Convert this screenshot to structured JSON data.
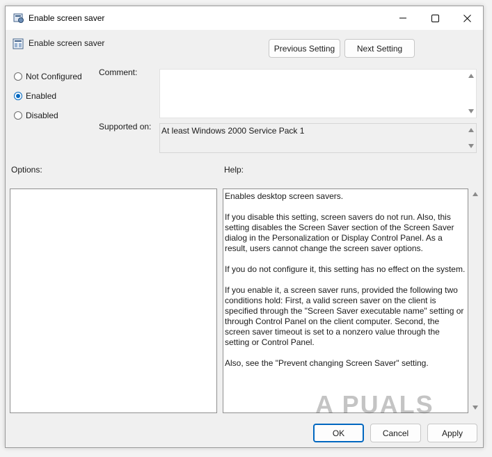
{
  "window": {
    "title": "Enable screen saver",
    "controls": {
      "minimize": "minimize",
      "maximize": "maximize",
      "close": "close"
    }
  },
  "header": {
    "title": "Enable screen saver",
    "previous_label": "Previous Setting",
    "next_label": "Next Setting"
  },
  "state": {
    "options": [
      {
        "label": "Not Configured",
        "checked": false
      },
      {
        "label": "Enabled",
        "checked": true
      },
      {
        "label": "Disabled",
        "checked": false
      }
    ]
  },
  "comment": {
    "label": "Comment:",
    "value": ""
  },
  "supported": {
    "label": "Supported on:",
    "value": "At least Windows 2000 Service Pack 1"
  },
  "options_label": "Options:",
  "help": {
    "label": "Help:",
    "paragraphs": [
      "Enables desktop screen savers.",
      "If you disable this setting, screen savers do not run. Also, this setting disables the Screen Saver section of the Screen Saver dialog in the Personalization or Display Control Panel. As a result, users cannot change the screen saver options.",
      "If you do not configure it, this setting has no effect on the system.",
      "If you enable it, a screen saver runs, provided the following two conditions hold: First, a valid screen saver on the client is specified through the \"Screen Saver executable name\" setting or through Control Panel on the client computer. Second, the screen saver timeout is set to a nonzero value through the setting or Control Panel.",
      "Also, see the \"Prevent changing Screen Saver\" setting."
    ]
  },
  "footer": {
    "ok_label": "OK",
    "cancel_label": "Cancel",
    "apply_label": "Apply"
  },
  "watermark": {
    "text": "A PUALS"
  },
  "colors": {
    "accent": "#0067c0",
    "window_bg": "#f0f0f0",
    "titlebar_bg": "#ffffff"
  }
}
